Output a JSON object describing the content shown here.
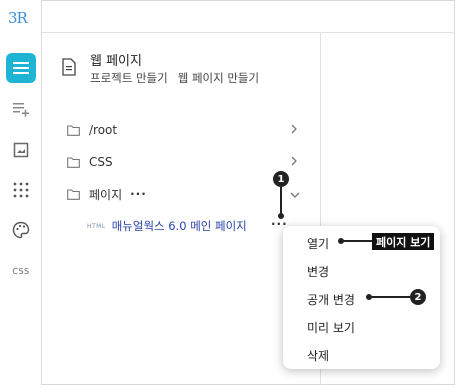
{
  "app": {
    "logo": "3R"
  },
  "rail": {
    "items": [
      {
        "icon": "menu-icon",
        "active": true
      },
      {
        "icon": "add-list-icon"
      },
      {
        "icon": "image-icon"
      },
      {
        "icon": "grid-dots-icon"
      },
      {
        "icon": "palette-icon"
      },
      {
        "icon": "css-icon",
        "label": "CSS"
      }
    ]
  },
  "panel": {
    "title": "웹 페이지",
    "breadcrumb": [
      "프로젝트 만들기",
      "웹 페이지 만들기"
    ]
  },
  "tree": {
    "folders": [
      {
        "label": "/root"
      },
      {
        "label": "CSS"
      },
      {
        "label": "페이지",
        "more": "···"
      }
    ],
    "file": {
      "type_tag": "HTML",
      "label": "매뉴얼웍스 6.0 메인 페이지",
      "more": "···"
    }
  },
  "context_menu": {
    "items": [
      "열기",
      "변경",
      "공개 변경",
      "미리 보기",
      "삭제"
    ]
  },
  "callouts": {
    "badge1": "1",
    "badge2": "2",
    "open_page_label": "페이지 보기"
  }
}
